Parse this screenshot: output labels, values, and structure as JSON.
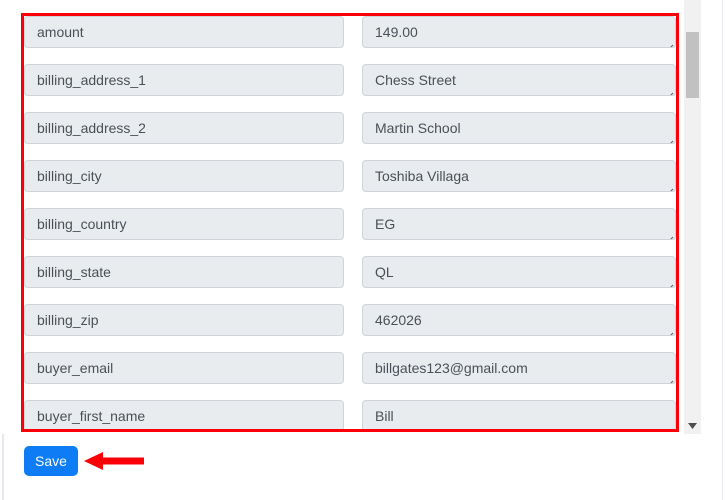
{
  "form": {
    "fields": [
      {
        "key": "amount",
        "value": "149.00"
      },
      {
        "key": "billing_address_1",
        "value": "Chess Street"
      },
      {
        "key": "billing_address_2",
        "value": "Martin School"
      },
      {
        "key": "billing_city",
        "value": "Toshiba Villaga"
      },
      {
        "key": "billing_country",
        "value": "EG"
      },
      {
        "key": "billing_state",
        "value": "QL"
      },
      {
        "key": "billing_zip",
        "value": "462026"
      },
      {
        "key": "buyer_email",
        "value": "billgates123@gmail.com"
      },
      {
        "key": "buyer_first_name",
        "value": "Bill"
      }
    ]
  },
  "actions": {
    "save_label": "Save"
  },
  "annotations": {
    "highlight_color": "#fb0007",
    "arrow_color": "#fb0007",
    "arrow_direction": "left",
    "arrow_target": "Save"
  },
  "scrollbar": {
    "orientation": "vertical",
    "thumb_position_percent": 8,
    "down_arrow_icon": "chevron-down-icon"
  },
  "theme": {
    "field_background": "#e9ecef",
    "field_border": "#ced4da",
    "field_text": "#495057",
    "primary_button": "#0d7cf5",
    "primary_button_text": "#ffffff",
    "page_background": "#ffffff"
  }
}
